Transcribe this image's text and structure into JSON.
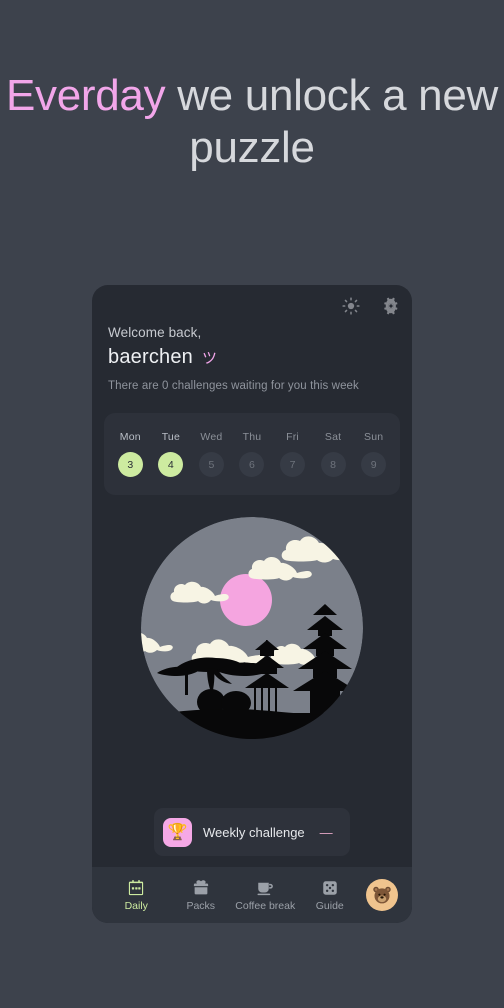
{
  "headline": {
    "accent_word": "Everday",
    "rest": " we unlock a new puzzle",
    "accent_color": "#f2a6ea"
  },
  "card": {
    "top_icons": [
      {
        "name": "sun-icon",
        "label": "Theme toggle"
      },
      {
        "name": "gear-icon",
        "label": "Settings"
      }
    ],
    "welcome_small": "Welcome back,",
    "username": "baerchen",
    "username_emoji": "ツ",
    "challenge_note": "There are 0 challenges waiting for you this week",
    "week": {
      "days": [
        {
          "name": "Mon",
          "date": "3",
          "active": true
        },
        {
          "name": "Tue",
          "date": "4",
          "active": true
        },
        {
          "name": "Wed",
          "date": "5",
          "active": false
        },
        {
          "name": "Thu",
          "date": "6",
          "active": false
        },
        {
          "name": "Fri",
          "date": "7",
          "active": false
        },
        {
          "name": "Sat",
          "date": "8",
          "active": false
        },
        {
          "name": "Sun",
          "date": "9",
          "active": false
        }
      ],
      "active_color": "#cdeba0"
    },
    "illustration": {
      "name": "japanese-night-scene",
      "sky_color": "#7b808a",
      "moon_color": "#f5a5e0",
      "cloud_color": "#f7f4e4",
      "silhouette_color": "#080809"
    },
    "weekly_challenge": {
      "icon": "trophy-icon",
      "label": "Weekly challenge",
      "dash": "—",
      "icon_bg": "#f5a8e6"
    },
    "nav": [
      {
        "label": "Daily",
        "icon": "calendar-icon",
        "active": true
      },
      {
        "label": "Packs",
        "icon": "gift-box-icon",
        "active": false
      },
      {
        "label": "Coffee break",
        "icon": "coffee-cup-icon",
        "active": false
      },
      {
        "label": "Guide",
        "icon": "dice-icon",
        "active": false
      }
    ],
    "avatar": {
      "name": "bear-avatar",
      "emoji": "🐻",
      "bg": "#f0c48e"
    }
  }
}
